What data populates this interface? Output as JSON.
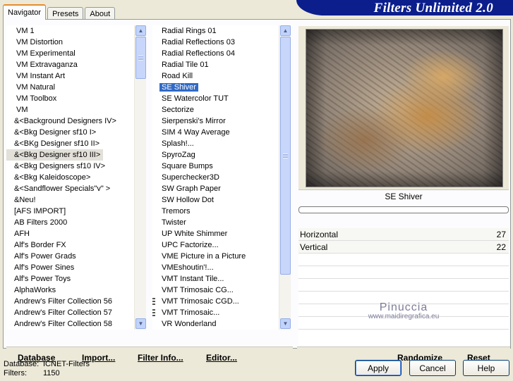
{
  "tabs": [
    {
      "label": "Navigator",
      "active": true
    },
    {
      "label": "Presets",
      "active": false
    },
    {
      "label": "About",
      "active": false
    }
  ],
  "title": "Filters Unlimited 2.0",
  "categories": [
    "VM 1",
    "VM Distortion",
    "VM Experimental",
    "VM Extravaganza",
    "VM Instant Art",
    "VM Natural",
    "VM Toolbox",
    "VM",
    "&<Background Designers IV>",
    "&<Bkg Designer sf10 I>",
    "&<BKg Designer sf10 II>",
    "&<Bkg Designer sf10 III>",
    "&<Bkg Designers sf10 IV>",
    "&<Bkg Kaleidoscope>",
    "&<Sandflower Specials\"v\" >",
    "&Neu!",
    "[AFS IMPORT]",
    "AB Filters 2000",
    "AFH",
    "Alf's Border FX",
    "Alf's Power Grads",
    "Alf's Power Sines",
    "Alf's Power Toys",
    "AlphaWorks",
    "Andrew's Filter Collection 56",
    "Andrew's Filter Collection 57",
    "Andrew's Filter Collection 58"
  ],
  "selected_category_index": 11,
  "filters": [
    "Radial  Rings 01",
    "Radial Reflections 03",
    "Radial Reflections 04",
    "Radial Tile 01",
    "Road Kill",
    "SE Shiver",
    "SE Watercolor TUT",
    "Sectorize",
    "Sierpenski's Mirror",
    "SIM 4 Way Average",
    "Splash!...",
    "SpyroZag",
    "Square Bumps",
    "Superchecker3D",
    "SW Graph Paper",
    "SW Hollow Dot",
    "Tremors",
    "Twister",
    "UP White Shimmer",
    "UPC Factorize...",
    "VME Picture in a Picture",
    "VMEshoutin'!...",
    "VMT Instant Tile...",
    "VMT Trimosaic CG...",
    "VMT Trimosaic CGD...",
    "VMT Trimosaic...",
    "VR Wonderland"
  ],
  "selected_filter_index": 5,
  "grip_filter_indices": [
    24,
    25
  ],
  "left_buttons": {
    "database": "Database",
    "import": "Import...",
    "filter_info": "Filter Info...",
    "editor": "Editor..."
  },
  "preview": {
    "filter_name": "SE Shiver"
  },
  "params": [
    {
      "label": "Horizontal",
      "value": "27"
    },
    {
      "label": "Vertical",
      "value": "22"
    }
  ],
  "watermark": {
    "line1": "Pinuccia",
    "line2": "www.maidiregrafica.eu"
  },
  "right_buttons": {
    "randomize": "Randomize",
    "reset": "Reset"
  },
  "status": {
    "database_label": "Database:",
    "database_value": "ICNET-Filters",
    "filters_label": "Filters:",
    "filters_value": "1150"
  },
  "dialog_buttons": {
    "apply": "Apply",
    "cancel": "Cancel",
    "help": "Help"
  },
  "colors": {
    "banner": "#0b1e8c",
    "selection": "#316ac5",
    "dialog_bg": "#ece9d8"
  }
}
